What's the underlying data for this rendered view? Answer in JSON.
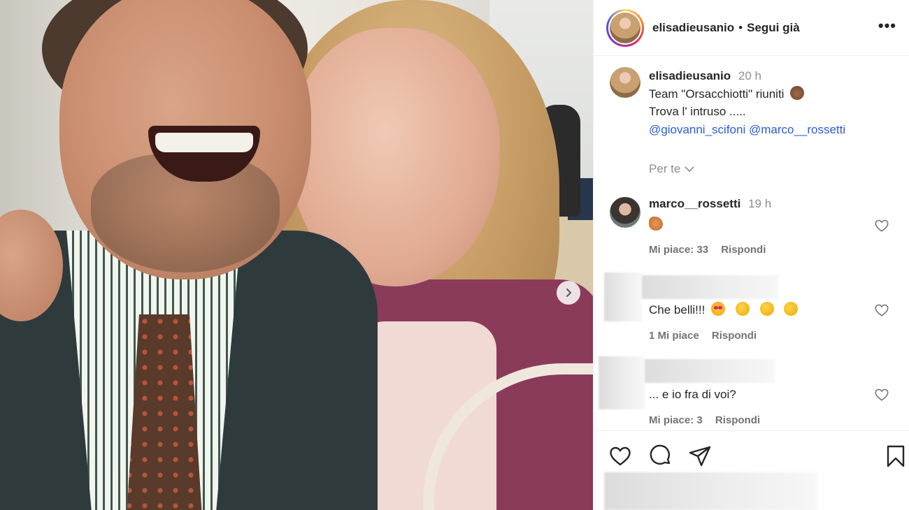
{
  "post": {
    "username": "elisadieusanio",
    "follow_label": "Segui già",
    "dot": "•",
    "more_label": "•••"
  },
  "caption": {
    "username": "elisadieusanio",
    "time": "20 h",
    "line1": "Team \"Orsacchiotti\" riuniti",
    "line1_emoji": "bear-face",
    "line2": "Trova l' intruso .....",
    "mention1": "@giovanni_scifoni",
    "mention2": "@marco__rossetti"
  },
  "for_you": {
    "label": "Per te"
  },
  "comments": [
    {
      "username": "marco__rossetti",
      "time": "19 h",
      "text_emoji": "horse",
      "likes": "Mi piace: 33",
      "reply": "Rispondi"
    },
    {
      "text": "Che belli!!!",
      "emojis": [
        "heart-eyes",
        "clapping-hands",
        "clapping-hands",
        "clapping-hands"
      ],
      "likes": "1 Mi piace",
      "reply": "Rispondi"
    },
    {
      "text": "... e io fra di voi?",
      "likes": "Mi piace: 3",
      "reply": "Rispondi"
    }
  ],
  "icons": {
    "like": "heart-icon",
    "comment": "comment-icon",
    "share": "paper-plane-icon",
    "save": "bookmark-icon",
    "next": "chevron-right-icon"
  },
  "colors": {
    "mention": "#2a5bd7",
    "muted": "#8e8e8e",
    "text": "#262626"
  }
}
